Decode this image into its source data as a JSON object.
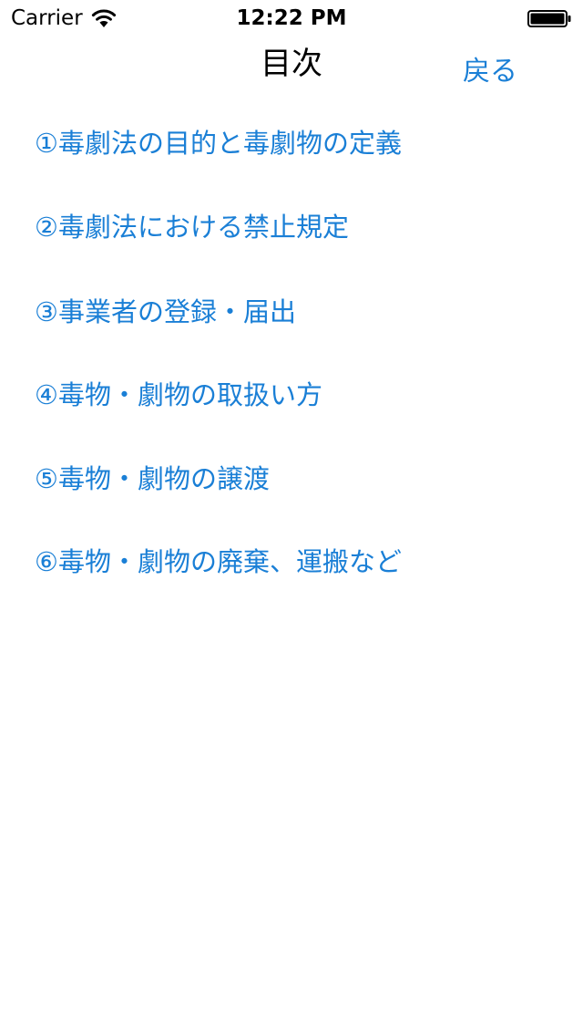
{
  "status_bar": {
    "carrier": "Carrier",
    "time": "12:22 PM",
    "wifi_icon": "wifi-icon",
    "battery_icon": "battery-icon",
    "battery_level": 1.0
  },
  "nav": {
    "title": "目次",
    "back_label": "戻る"
  },
  "toc": {
    "items": [
      "①毒劇法の目的と毒劇物の定義",
      "②毒劇法における禁止規定",
      "③事業者の登録・届出",
      "④毒物・劇物の取扱い方",
      "⑤毒物・劇物の譲渡",
      "⑥毒物・劇物の廃棄、運搬など"
    ]
  },
  "colors": {
    "accent": "#1a7fd6",
    "text": "#000000",
    "background": "#ffffff"
  }
}
